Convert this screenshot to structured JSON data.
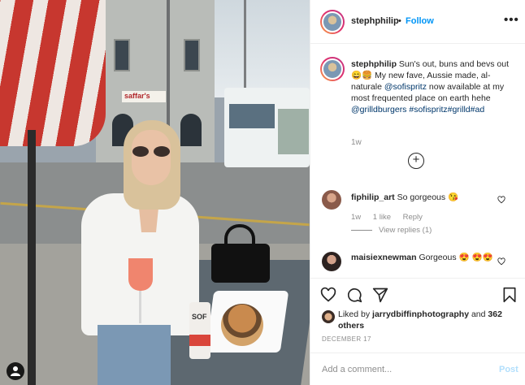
{
  "header": {
    "username": "stephphilip",
    "separator": "•",
    "follow_label": "Follow",
    "more_label": "•••"
  },
  "caption": {
    "username": "stephphilip",
    "text_1": "Sun's out, buns and bevs out 😄🍔 My new fave, Aussie made, al-naturale",
    "mention_1": "@sofispritz",
    "text_2": "now available at my most frequented place on earth hehe",
    "mention_2": "@grilldburgers",
    "hashtags": "#sofispritz#grilld#ad",
    "time": "1w",
    "load_more": "+"
  },
  "comments": [
    {
      "username": "fiphilip_art",
      "text": "So gorgeous 😘",
      "time": "1w",
      "likes": "1 like",
      "reply_label": "Reply",
      "view_replies": "View replies (1)"
    },
    {
      "username": "maisiexnewman",
      "text": "Gorgeous 😍 😍😍"
    }
  ],
  "likes": {
    "prefix": "Liked by",
    "user": "jarrydbiffinphotography",
    "and": "and",
    "others": "362 others"
  },
  "date": "DECEMBER 17",
  "add_comment": {
    "placeholder": "Add a comment...",
    "post_label": "Post"
  },
  "photo": {
    "shop_sign": "saffar's",
    "can_text": "SOF"
  },
  "icons": [
    "heart-icon",
    "comment-icon",
    "share-icon",
    "bookmark-icon",
    "tag-user-icon",
    "more-options-icon"
  ],
  "colors": {
    "follow": "#0095f6",
    "link": "#00376b",
    "muted": "#8e8e8e",
    "post_disabled": "#b2dffc"
  }
}
